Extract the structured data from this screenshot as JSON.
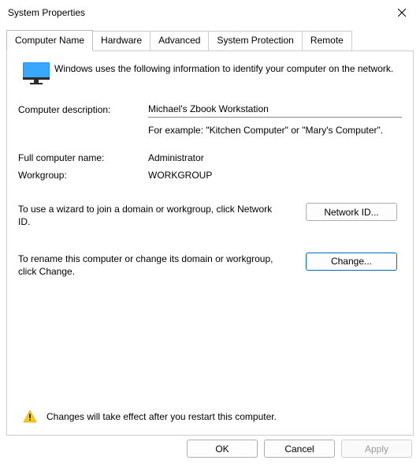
{
  "window": {
    "title": "System Properties"
  },
  "tabs": [
    {
      "label": "Computer Name",
      "active": true
    },
    {
      "label": "Hardware"
    },
    {
      "label": "Advanced"
    },
    {
      "label": "System Protection"
    },
    {
      "label": "Remote"
    }
  ],
  "info_text": "Windows uses the following information to identify your computer on the network.",
  "description": {
    "label": "Computer description:",
    "value": "Michael's Zbook Workstation",
    "example": "For example: \"Kitchen Computer\" or \"Mary's Computer\"."
  },
  "full_name": {
    "label": "Full computer name:",
    "value": "Administrator"
  },
  "workgroup": {
    "label": "Workgroup:",
    "value": "WORKGROUP"
  },
  "network_id": {
    "text": "To use a wizard to join a domain or workgroup, click Network ID.",
    "button": "Network ID..."
  },
  "change": {
    "text": "To rename this computer or change its domain or workgroup, click Change.",
    "button": "Change..."
  },
  "warning": "Changes will take effect after you restart this computer.",
  "footer": {
    "ok": "OK",
    "cancel": "Cancel",
    "apply": "Apply"
  },
  "icons": {
    "close": "close-icon",
    "monitor": "monitor-icon",
    "warning": "warning-icon"
  }
}
